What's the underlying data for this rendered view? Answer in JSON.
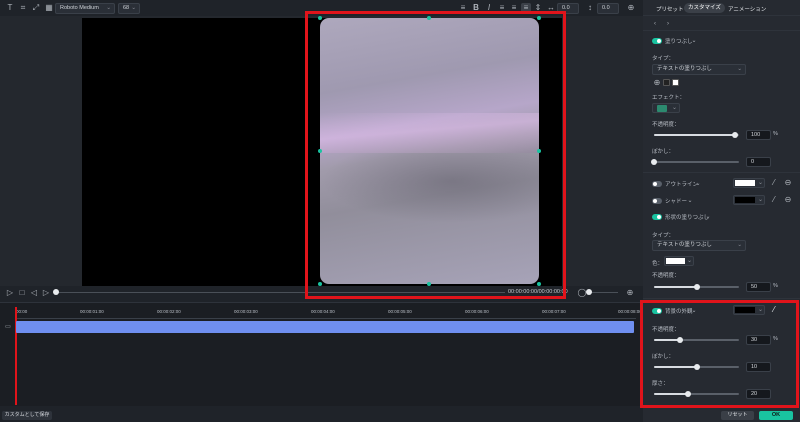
{
  "toolbar": {
    "font_name": "Roboto Medium",
    "font_size": "68",
    "spacing_value": "0.0",
    "line_value": "0.0"
  },
  "tabs": [
    "プリセット",
    "カスタマイズ",
    "アニメーション"
  ],
  "panel": {
    "fill": {
      "title": "塗りつぶし",
      "type_label": "タイプ：",
      "type_value": "テキストの塗りつぶし",
      "effect_label": "エフェクト：",
      "opacity_label": "不透明度：",
      "opacity_value": "100",
      "opacity_fraction": 0.95,
      "blur_label": "ぼかし：",
      "blur_value": "0",
      "blur_fraction": 0.0,
      "percent": "%"
    },
    "outline": {
      "title": "アウトライン",
      "color": "#ffffff"
    },
    "shadow": {
      "title": "シャドー",
      "color": "#000000"
    },
    "fill2": {
      "title": "形状の塗りつぶし",
      "type_label": "タイプ：",
      "type_value": "テキストの塗りつぶし",
      "color_label": "色：",
      "color_value": "#ffffff",
      "opacity_label": "不透明度：",
      "opacity_value": "50",
      "opacity_fraction": 0.5,
      "percent": "%"
    },
    "glow": {
      "title": "背景の外観",
      "color": "#000000",
      "opacity_label": "不透明度：",
      "opacity_value": "30",
      "opacity_fraction": 0.3,
      "percent": "%",
      "blur_label": "ぼかし：",
      "blur_value": "10",
      "blur_fraction": 0.5,
      "spread_label": "厚さ：",
      "spread_value": "20",
      "spread_fraction": 0.4
    }
  },
  "playback": {
    "timecode": "00:00:00:00/00:00:00:00"
  },
  "timeline": {
    "ruler": [
      "00:00",
      "00:00:01:00",
      "00:00:02:00",
      "00:00:03:00",
      "00:00:04:00",
      "00:00:05:00",
      "00:00:06:00",
      "00:00:07:00",
      "00:00:08:00"
    ]
  },
  "footer": {
    "save_custom": "カスタムとして保存",
    "reset": "リセット",
    "ok": "OK"
  },
  "colors": {
    "accent": "#19c3a0",
    "highlight": "#e0141b",
    "clip": "#6f8ff0"
  }
}
